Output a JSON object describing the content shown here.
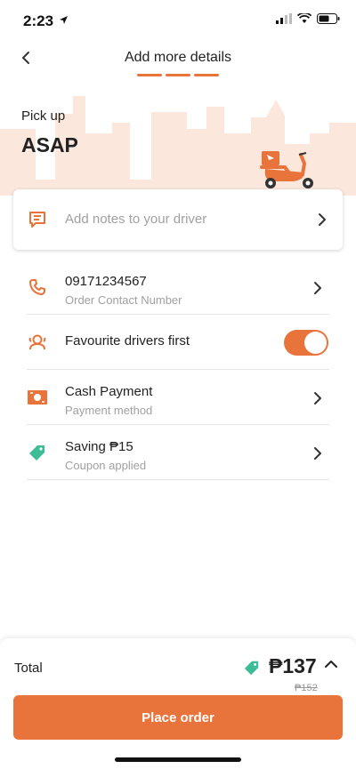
{
  "status_bar": {
    "time": "2:23"
  },
  "header": {
    "title": "Add more details",
    "back_icon": "chevron-left-icon"
  },
  "pickup": {
    "label": "Pick up",
    "value": "ASAP"
  },
  "notes": {
    "placeholder": "Add notes to your driver",
    "icon": "message-icon"
  },
  "rows": [
    {
      "title": "09171234567",
      "subtitle": "Order Contact Number",
      "icon": "phone-icon"
    },
    {
      "title": "Favourite drivers first",
      "icon": "drivers-icon",
      "toggle_on": true
    },
    {
      "title": "Cash Payment",
      "subtitle": "Payment method",
      "icon": "cash-icon"
    },
    {
      "title": "Saving ₱15",
      "subtitle": "Coupon applied",
      "icon": "tag-icon"
    }
  ],
  "footer": {
    "total_label": "Total",
    "total_price": "₱137",
    "old_price": "₱152",
    "place_order": "Place order"
  },
  "colors": {
    "accent": "#e8743b",
    "coupon_green": "#3dbd97",
    "muted": "#a0a0a0",
    "skyline": "#fbe7db"
  }
}
